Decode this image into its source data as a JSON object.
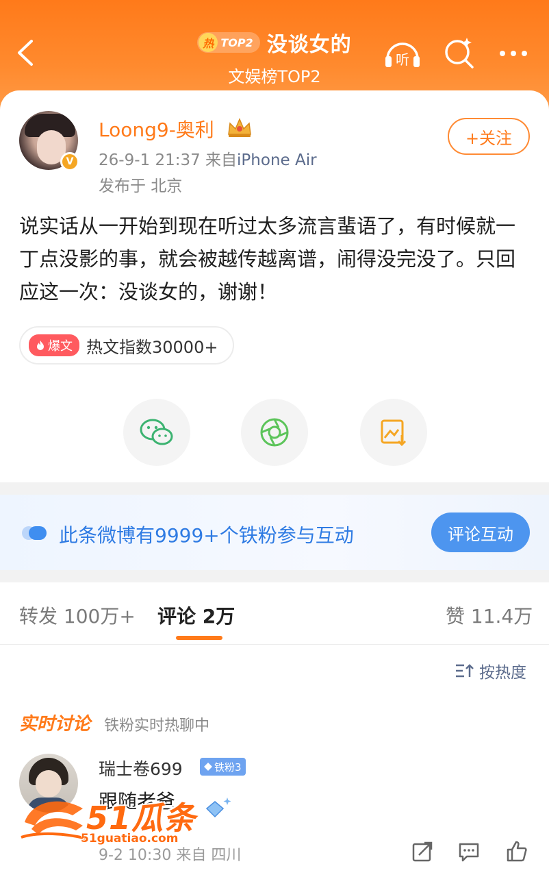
{
  "header": {
    "hot_char": "热",
    "hot_rank_badge": "TOP2",
    "title": "没谈女的",
    "subtitle": "文娱榜TOP2",
    "listen_label": "听"
  },
  "post": {
    "username": "Loong9-奥利",
    "time": "26-9-1 21:37",
    "from_prefix": "来自",
    "source": "iPhone Air",
    "location": "发布于 北京",
    "follow_label": "+关注",
    "verified_mark": "V",
    "text": "说实话从一开始到现在听过太多流言蜚语了，有时候就一丁点没影的事，就会被越传越离谱，闹得没完没了。只回应这一次：没谈女的，谢谢！",
    "hot_tag_badge": "爆文",
    "hot_tag_text": "热文指数30000+"
  },
  "share": {
    "icons": [
      "wechat-icon",
      "moments-icon",
      "save-image-icon"
    ]
  },
  "fans_bar": {
    "text": "此条微博有9999+个铁粉参与互动",
    "button": "评论互动"
  },
  "tabs": {
    "repost": "转发 100万+",
    "comment": "评论 2万",
    "like": "赞 11.4万"
  },
  "sort_label": "按热度",
  "realtime": {
    "title": "实时讨论",
    "subtitle": "铁粉实时热聊中"
  },
  "comment": {
    "username": "瑞士卷699",
    "badge": "铁粉3",
    "text": "跟随老爸",
    "meta": "9-2 10:30 来自 四川"
  },
  "watermark": {
    "main": "51瓜条",
    "url": "51guatiao.com"
  },
  "colors": {
    "accent": "#ff7a1a",
    "link_blue": "#2f7be3",
    "button_blue": "#4d95ef"
  }
}
